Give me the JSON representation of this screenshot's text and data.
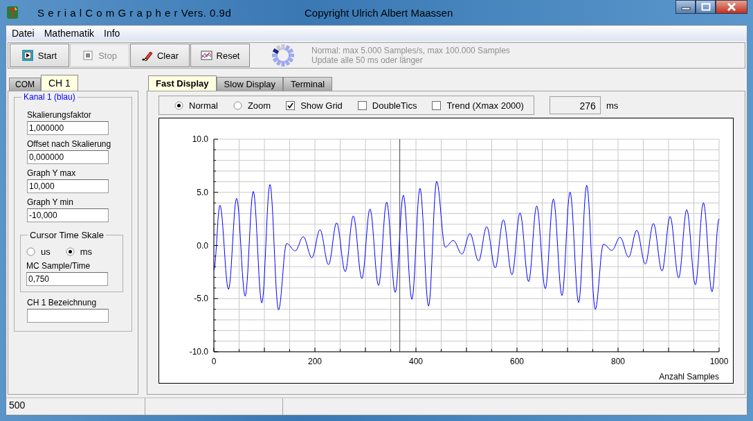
{
  "window": {
    "title": "S e r i a l C o m G r a p h e r  Vers. 0.9d",
    "copyright": "Copyright Ulrich Albert Maassen"
  },
  "menu": [
    "Datei",
    "Mathematik",
    "Info"
  ],
  "toolbar": [
    {
      "kind": "play",
      "label": "Start",
      "disabled": false
    },
    {
      "kind": "stop",
      "label": "Stop",
      "disabled": true
    },
    {
      "kind": "eraser",
      "label": "Clear",
      "disabled": false
    },
    {
      "kind": "graph",
      "label": "Reset",
      "disabled": false
    }
  ],
  "info": [
    "Normal: max 5.000 Samples/s, max 100.000 Samples",
    "Update alle 50 ms oder länger"
  ],
  "side_tabs": [
    {
      "label": "COM",
      "selected": false
    },
    {
      "label": "CH 1",
      "selected": true
    }
  ],
  "channel": {
    "legend": "Kanal 1 (blau)",
    "fields": [
      {
        "label": "Skalierungsfaktor",
        "value": "1,000000"
      },
      {
        "label": "Offset nach Skalierung",
        "value": "0,000000"
      },
      {
        "label": "Graph  Y max",
        "value": "10,000"
      },
      {
        "label": "Graph  Y min",
        "value": "-10,000"
      }
    ]
  },
  "cursor_scale": {
    "legend": "Cursor Time Skale",
    "radios": [
      {
        "label": "us",
        "selected": false
      },
      {
        "label": "ms",
        "selected": true
      }
    ],
    "field": {
      "label": "MC Sample/Time",
      "value": "0,750"
    }
  },
  "name_field": {
    "label": "CH 1  Bezeichnung"
  },
  "main_tabs": [
    {
      "label": "Fast Display",
      "selected": true
    },
    {
      "label": "Slow Display",
      "selected": false
    },
    {
      "label": "Terminal",
      "selected": false
    }
  ],
  "options": [
    {
      "kind": "radio",
      "label": "Normal",
      "selected": true
    },
    {
      "kind": "radio",
      "label": "Zoom",
      "selected": false
    },
    {
      "kind": "checkbox",
      "label": "Show Grid",
      "checked": true
    },
    {
      "kind": "checkbox",
      "label": "DoubleTics",
      "checked": false
    },
    {
      "kind": "checkbox",
      "label": "Trend (Xmax 2000)",
      "checked": false
    }
  ],
  "readout": {
    "value": "276",
    "unit": "ms"
  },
  "chart": {
    "chart_data": {
      "type": "line",
      "xlabel": "Anzahl Samples",
      "xlim": [
        0,
        1000
      ],
      "ylim": [
        -10,
        10
      ],
      "xticks": [
        0,
        200,
        400,
        600,
        800,
        1000
      ],
      "yticks": [
        {
          "value": 10,
          "label": "10.0"
        },
        {
          "value": 5,
          "label": "5.0"
        },
        {
          "value": 0,
          "label": "0.0"
        },
        {
          "value": -5,
          "label": "-5.0"
        },
        {
          "value": -10,
          "label": "-10.0"
        }
      ],
      "grid": true,
      "ref_lines": [
        {
          "axis": "x",
          "value": 368,
          "color": "#404040"
        }
      ],
      "x": [
        0,
        12,
        29,
        45,
        62,
        78,
        95,
        111,
        128,
        144,
        161,
        177,
        194,
        210,
        227,
        243,
        260,
        276,
        293,
        309,
        326,
        342,
        359,
        375,
        392,
        408,
        425,
        441,
        458,
        474,
        491,
        507,
        524,
        540,
        557,
        573,
        590,
        606,
        623,
        639,
        656,
        672,
        689,
        705,
        722,
        738,
        755,
        771,
        788,
        804,
        821,
        837,
        854,
        870,
        887,
        903,
        920,
        936,
        953,
        969,
        986,
        1000
      ],
      "series": [
        {
          "color": "#0000ff",
          "values": [
            -2.3,
            3.78,
            -4.12,
            4.43,
            -4.77,
            5.08,
            -5.41,
            5.73,
            -6.06,
            0.18,
            -0.51,
            0.83,
            -1.16,
            1.48,
            -1.81,
            2.13,
            -2.46,
            2.78,
            -3.11,
            3.43,
            -3.76,
            4.08,
            -4.41,
            4.73,
            -5.06,
            5.38,
            -5.71,
            6.03,
            -0.16,
            0.47,
            -0.81,
            1.12,
            -1.46,
            1.77,
            -2.11,
            2.42,
            -2.76,
            3.07,
            -3.4,
            3.72,
            -4.06,
            4.37,
            -4.71,
            5.02,
            -5.36,
            5.67,
            -6.0,
            0.12,
            -0.45,
            0.77,
            -1.1,
            1.42,
            -1.75,
            2.07,
            -2.4,
            2.72,
            -3.05,
            3.37,
            -3.7,
            4.02,
            -4.35,
            2.5
          ]
        }
      ]
    }
  },
  "status_bar": [
    "500"
  ]
}
